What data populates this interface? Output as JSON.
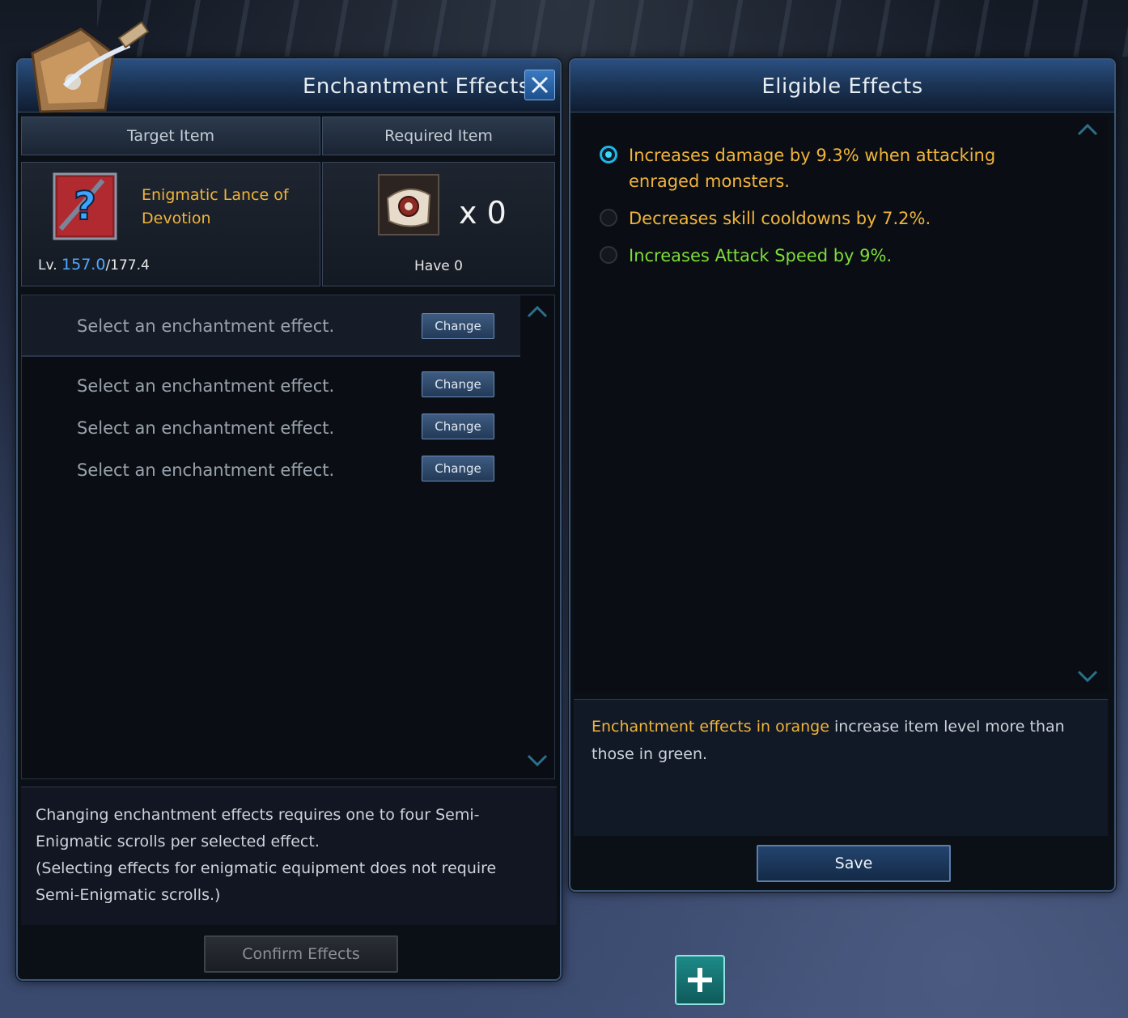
{
  "left_panel": {
    "title": "Enchantment Effects",
    "columns": {
      "target": "Target Item",
      "required": "Required Item"
    },
    "target_item": {
      "name": "Enigmatic Lance of Devotion",
      "level_prefix": "Lv.",
      "level_current": "157.0",
      "level_max": "/177.4"
    },
    "required_item": {
      "quantity": "x 0",
      "have": "Have 0"
    },
    "slots": [
      {
        "text": "Select an enchantment effect.",
        "button": "Change"
      },
      {
        "text": "Select an enchantment effect.",
        "button": "Change"
      },
      {
        "text": "Select an enchantment effect.",
        "button": "Change"
      },
      {
        "text": "Select an enchantment effect.",
        "button": "Change"
      }
    ],
    "description_lines": [
      "Changing enchantment effects requires one to four Semi-Enigmatic scrolls per selected effect.",
      "(Selecting effects for enigmatic equipment does not require Semi-Enigmatic scrolls.)"
    ],
    "confirm_button": "Confirm Effects"
  },
  "right_panel": {
    "title": "Eligible Effects",
    "effects": [
      {
        "text": "Increases damage by 9.3% when attacking enraged monsters.",
        "color": "#f0b43a",
        "selected": true
      },
      {
        "text": "Decreases skill cooldowns by 7.2%.",
        "color": "#f0b43a",
        "selected": false
      },
      {
        "text": "Increases Attack Speed by 9%.",
        "color": "#7ddc3a",
        "selected": false
      }
    ],
    "note": {
      "highlight": "Enchantment effects in orange",
      "rest": " increase item level more than those in green."
    },
    "save_button": "Save"
  },
  "colors": {
    "orange": "#f0b43a",
    "green": "#7ddc3a",
    "level_blue": "#4fa8ff",
    "accent": "#1fb7e6"
  },
  "icons": [
    "emblem-icon",
    "close-icon",
    "item-icon",
    "scroll-icon",
    "chevron-up-icon",
    "chevron-down-icon",
    "plus-icon"
  ]
}
